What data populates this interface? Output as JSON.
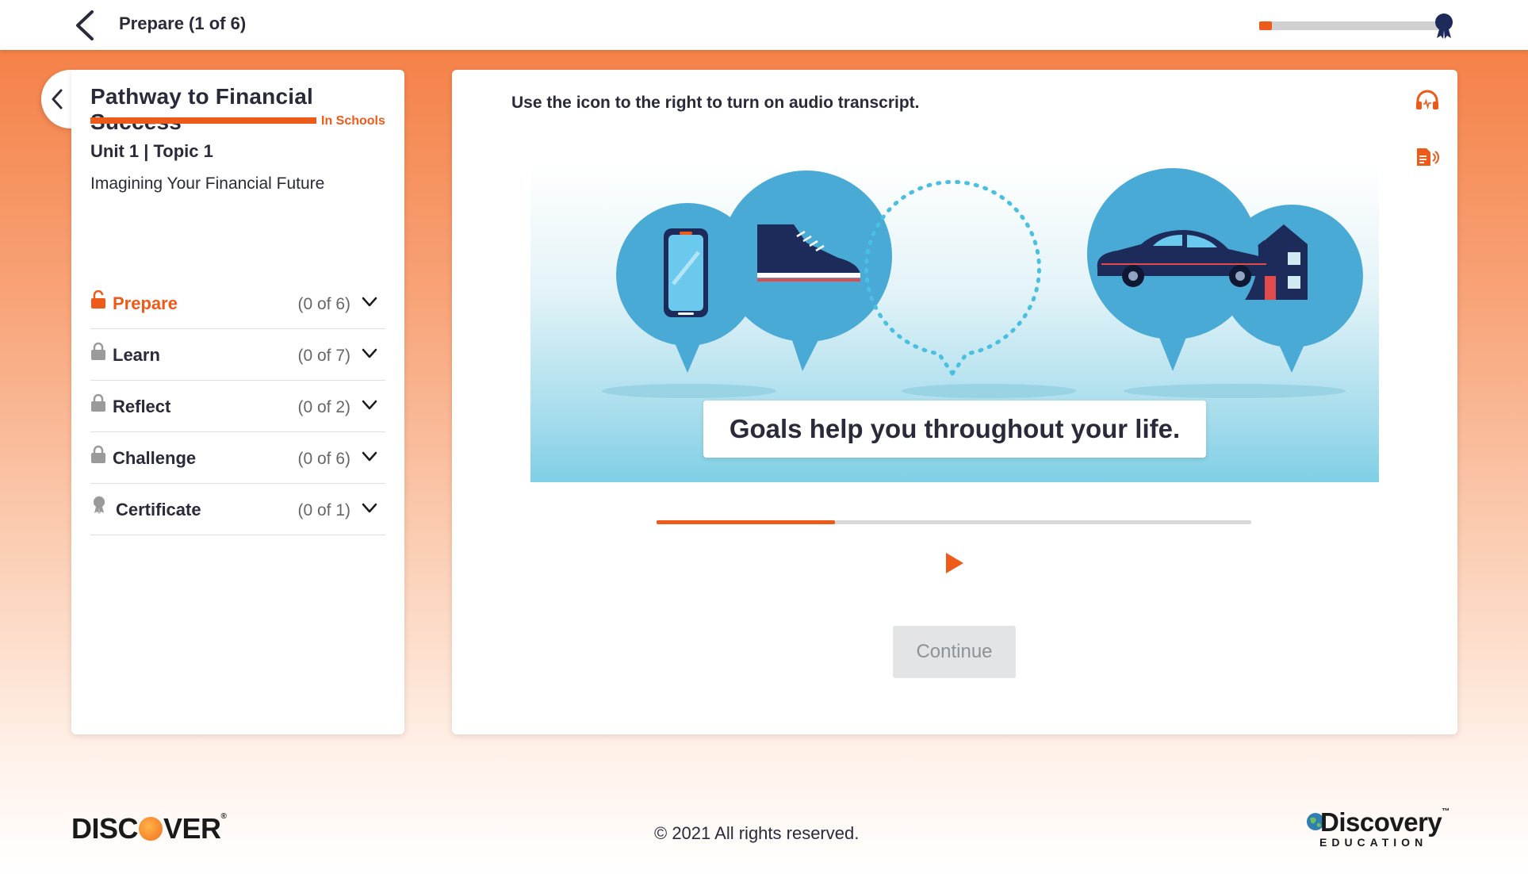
{
  "header": {
    "title": "Prepare (1 of 6)",
    "progress_fraction": 0.07
  },
  "sidebar": {
    "brand_title": "Pathway to Financial Success",
    "brand_subtitle": "In Schools",
    "unit_label": "Unit 1 | Topic 1",
    "topic_name": "Imagining Your Financial Future",
    "sections": [
      {
        "label": "Prepare",
        "count": "(0 of 6)",
        "icon": "unlocked-lock-icon",
        "active": true
      },
      {
        "label": "Learn",
        "count": "(0 of 7)",
        "icon": "lock-icon",
        "active": false
      },
      {
        "label": "Reflect",
        "count": "(0 of 2)",
        "icon": "lock-icon",
        "active": false
      },
      {
        "label": "Challenge",
        "count": "(0 of 6)",
        "icon": "lock-icon",
        "active": false
      },
      {
        "label": "Certificate",
        "count": "(0 of 1)",
        "icon": "award-ribbon-icon",
        "active": false
      }
    ]
  },
  "main": {
    "instruction": "Use the icon to the right to turn on audio transcript.",
    "caption": "Goals help you throughout your life.",
    "media_progress_fraction": 0.3,
    "continue_label": "Continue"
  },
  "footer": {
    "left_logo_before": "DISC",
    "left_logo_after": "VER",
    "left_logo_mark": "®",
    "copyright": "© 2021 All rights reserved.",
    "right_logo_name": "Discovery",
    "right_logo_sub": "EDUCATION",
    "right_logo_mark": "™"
  },
  "colors": {
    "accent": "#ee5a1a",
    "text": "#2a2a3a",
    "bubble": "#4aaad6",
    "navy": "#1d2b5a"
  }
}
